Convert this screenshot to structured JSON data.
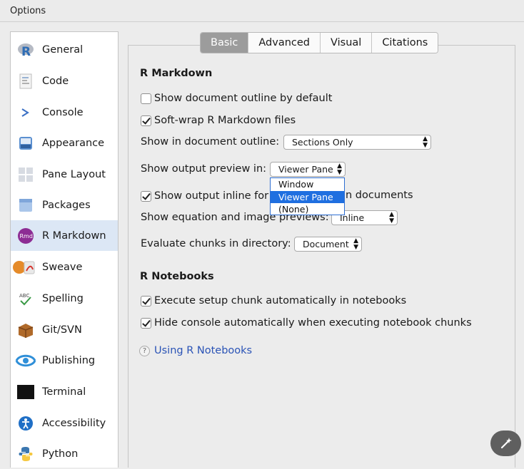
{
  "window": {
    "title": "Options"
  },
  "sidebar": {
    "items": [
      {
        "label": "General",
        "icon": "r-logo-icon"
      },
      {
        "label": "Code",
        "icon": "code-doc-icon"
      },
      {
        "label": "Console",
        "icon": "console-prompt-icon"
      },
      {
        "label": "Appearance",
        "icon": "appearance-icon"
      },
      {
        "label": "Pane Layout",
        "icon": "pane-layout-icon"
      },
      {
        "label": "Packages",
        "icon": "packages-icon"
      },
      {
        "label": "R Markdown",
        "icon": "rmd-icon",
        "active": true
      },
      {
        "label": "Sweave",
        "icon": "sweave-icon"
      },
      {
        "label": "Spelling",
        "icon": "spelling-icon"
      },
      {
        "label": "Git/SVN",
        "icon": "git-box-icon"
      },
      {
        "label": "Publishing",
        "icon": "publishing-icon"
      },
      {
        "label": "Terminal",
        "icon": "terminal-icon"
      },
      {
        "label": "Accessibility",
        "icon": "accessibility-icon"
      },
      {
        "label": "Python",
        "icon": "python-icon"
      }
    ]
  },
  "tabs": [
    {
      "label": "Basic",
      "active": true
    },
    {
      "label": "Advanced"
    },
    {
      "label": "Visual"
    },
    {
      "label": "Citations"
    }
  ],
  "rmarkdown": {
    "heading": "R Markdown",
    "show_outline": {
      "label": "Show document outline by default",
      "checked": false
    },
    "soft_wrap": {
      "label": "Soft-wrap R Markdown files",
      "checked": true
    },
    "outline_label": "Show in document outline:",
    "outline_value": "Sections Only",
    "preview_label": "Show output preview in:",
    "preview_value": "Viewer Pane",
    "preview_options": [
      "Window",
      "Viewer Pane",
      "(None)"
    ],
    "inline_output": {
      "label_left": "Show output inline for",
      "label_right": "n documents",
      "checked": true
    },
    "equation_label": "Show equation and image previews:",
    "equation_value": "Inline",
    "eval_label": "Evaluate chunks in directory:",
    "eval_value": "Document"
  },
  "notebooks": {
    "heading": "R Notebooks",
    "setup_chunk": {
      "label": "Execute setup chunk automatically in notebooks",
      "checked": true
    },
    "hide_console": {
      "label": "Hide console automatically when executing notebook chunks",
      "checked": true
    },
    "link": "Using R Notebooks"
  },
  "colors": {
    "selection": "#1f6fe0",
    "sidebar_active": "#dce7f5",
    "link": "#2a53b6"
  }
}
